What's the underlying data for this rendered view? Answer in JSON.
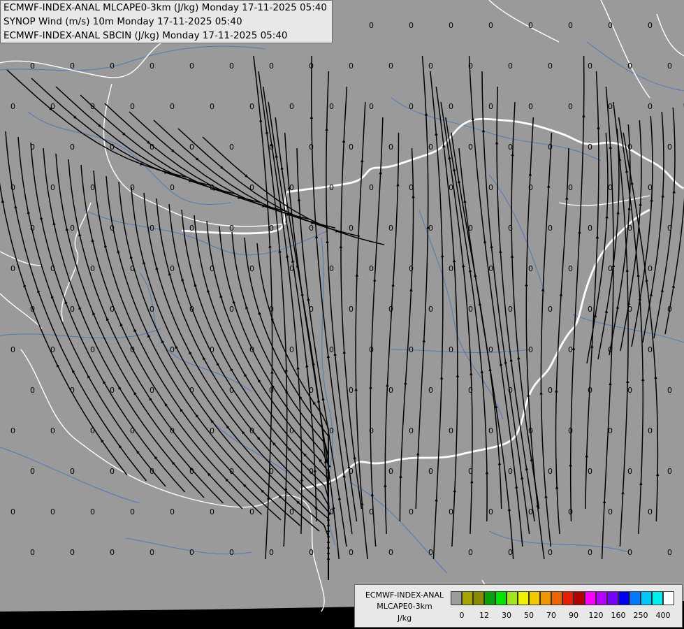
{
  "header": {
    "lines": [
      "ECMWF-INDEX-ANAL MLCAPE0-3km (J/kg) Monday 17-11-2025 05:40",
      "SYNOP Wind (m/s) 10m Monday 17-11-2025 05:40",
      "ECMWF-INDEX-ANAL SBCIN (J/kg) Monday 17-11-2025 05:40"
    ]
  },
  "legend": {
    "title_lines": [
      "ECMWF-INDEX-ANAL",
      "MLCAPE0-3km",
      "J/kg"
    ],
    "colors": [
      "#9c9c9c",
      "#a7a300",
      "#8c8a00",
      "#0aa20a",
      "#00e600",
      "#a0e61e",
      "#f0f000",
      "#f0c800",
      "#f09600",
      "#f06400",
      "#e61e00",
      "#b40000",
      "#ff00ff",
      "#b400ff",
      "#7800ff",
      "#0000f0",
      "#0078ff",
      "#00c8ff",
      "#00f0f0",
      "#ffffff"
    ],
    "ticks": [
      "0",
      "12",
      "30",
      "50",
      "70",
      "90",
      "120",
      "160",
      "250",
      "400"
    ]
  },
  "map": {
    "background": "#9a9a9a",
    "border_color": "#ffffff",
    "river_color": "#4f79b8",
    "stream_color": "#000000",
    "value_label": "0"
  }
}
